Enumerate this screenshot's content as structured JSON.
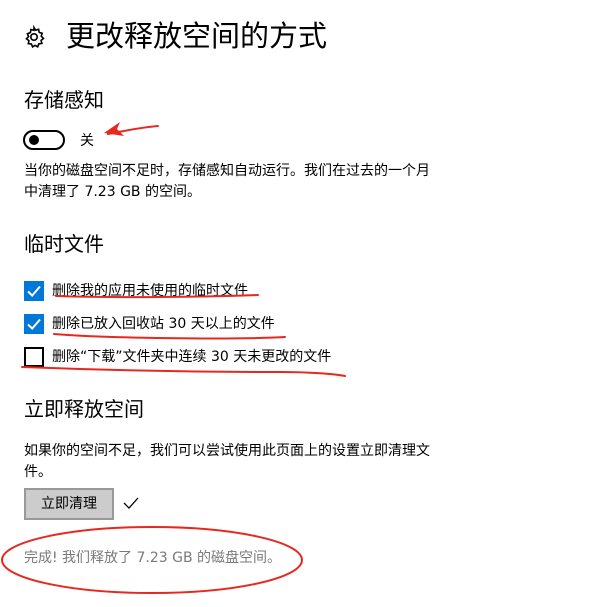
{
  "header": {
    "title": "更改释放空间的方式",
    "icon": "gear-icon"
  },
  "storage_sense": {
    "title": "存储感知",
    "toggle_state_label": "关",
    "toggle_on": false,
    "description_line1": "当你的磁盘空间不足时，存储感知自动运行。我们在过去的一个月",
    "description_line2": "中清理了 7.23 GB 的空间。"
  },
  "temp_files": {
    "title": "临时文件",
    "options": [
      {
        "label": "删除我的应用未使用的临时文件",
        "checked": true
      },
      {
        "label": "删除已放入回收站 30 天以上的文件",
        "checked": true
      },
      {
        "label": "删除“下载”文件夹中连续 30 天未更改的文件",
        "checked": false
      }
    ]
  },
  "free_now": {
    "title": "立即释放空间",
    "description_line1": "如果你的空间不足，我们可以尝试使用此页面上的设置立即清理文",
    "description_line2": "件。",
    "button_label": "立即清理",
    "status": "完成! 我们释放了 7.23 GB 的磁盘空间。"
  },
  "colors": {
    "accent": "#0078d7",
    "annotation_red": "#e8281f",
    "status_gray": "#7a7a7a"
  }
}
